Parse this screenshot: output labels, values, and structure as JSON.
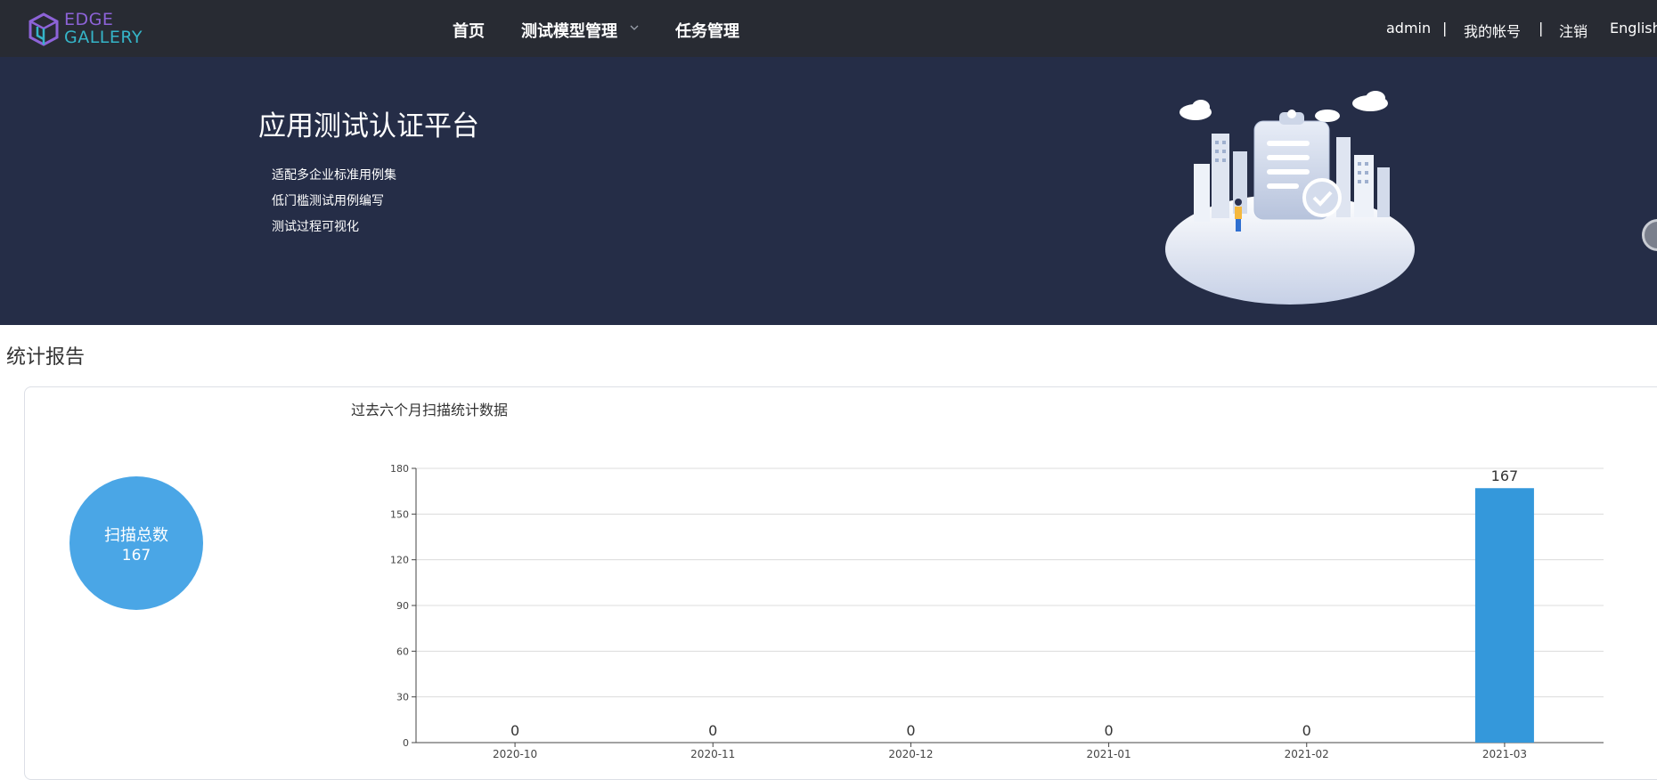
{
  "header": {
    "logo": {
      "line1": "EDGE",
      "line2": "GALLERY",
      "icon": "edgegallery-cube-icon"
    },
    "nav": [
      {
        "label": "首页"
      },
      {
        "label": "测试模型管理",
        "has_dropdown": true
      },
      {
        "label": "任务管理"
      }
    ],
    "user": {
      "username": "admin",
      "separator": "|",
      "account": "我的帐号",
      "logout": "注销",
      "language": "English"
    }
  },
  "banner": {
    "title": "应用测试认证平台",
    "features": [
      "适配多企业标准用例集",
      "低门槛测试用例编写",
      "测试过程可视化"
    ],
    "illustration": "city-clipboard-illustration"
  },
  "stats": {
    "section_title": "统计报告",
    "total_label": "扫描总数",
    "total_value": "167",
    "chart_title": "过去六个月扫描统计数据"
  },
  "colors": {
    "topbar": "#282b33",
    "banner": "#252d47",
    "circle": "#4aa6e6",
    "bar": "#3498db"
  },
  "chart_data": {
    "type": "bar",
    "title": "过去六个月扫描统计数据",
    "categories": [
      "2020-10",
      "2020-11",
      "2020-12",
      "2021-01",
      "2021-02",
      "2021-03"
    ],
    "values": [
      0,
      0,
      0,
      0,
      0,
      167
    ],
    "data_labels": [
      "0",
      "0",
      "0",
      "0",
      "0",
      "167"
    ],
    "yticks": [
      "0",
      "30",
      "60",
      "90",
      "120",
      "150",
      "180"
    ],
    "ylim": [
      0,
      180
    ],
    "xlabel": "",
    "ylabel": "",
    "grid": true,
    "legend": false
  }
}
